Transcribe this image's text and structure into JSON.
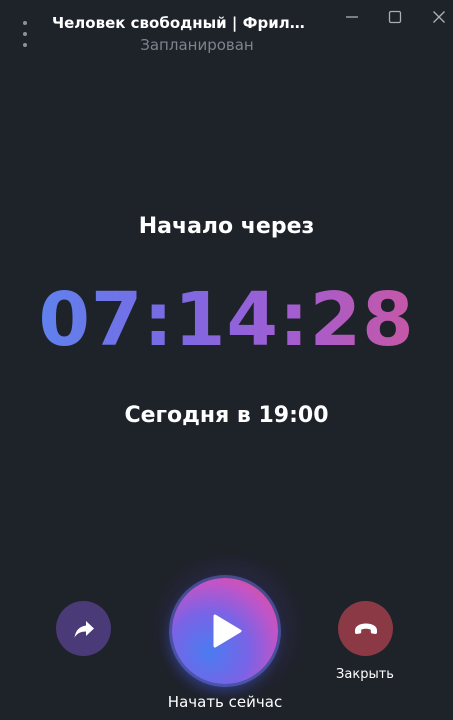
{
  "window": {
    "title": "Человек свободный | Фрила...",
    "status": "Запланирован"
  },
  "main": {
    "starts_label": "Начало через",
    "countdown": "07:14:28",
    "scheduled_time": "Сегодня в 19:00"
  },
  "controls": {
    "start_label": "Начать сейчас",
    "close_label": "Закрыть"
  },
  "icons": {
    "menu": "more-vertical-icon",
    "minimize": "minimize-icon",
    "maximize": "maximize-icon",
    "close_window": "close-icon",
    "share": "share-arrow-icon",
    "play": "play-icon",
    "hangup": "hang-up-icon"
  },
  "colors": {
    "background": "#1e2229",
    "share_button": "#4b3a78",
    "close_button": "#8b3a45",
    "countdown_gradient_start": "#5f82ee",
    "countdown_gradient_end": "#c757a5",
    "status_text": "#7d848f"
  }
}
